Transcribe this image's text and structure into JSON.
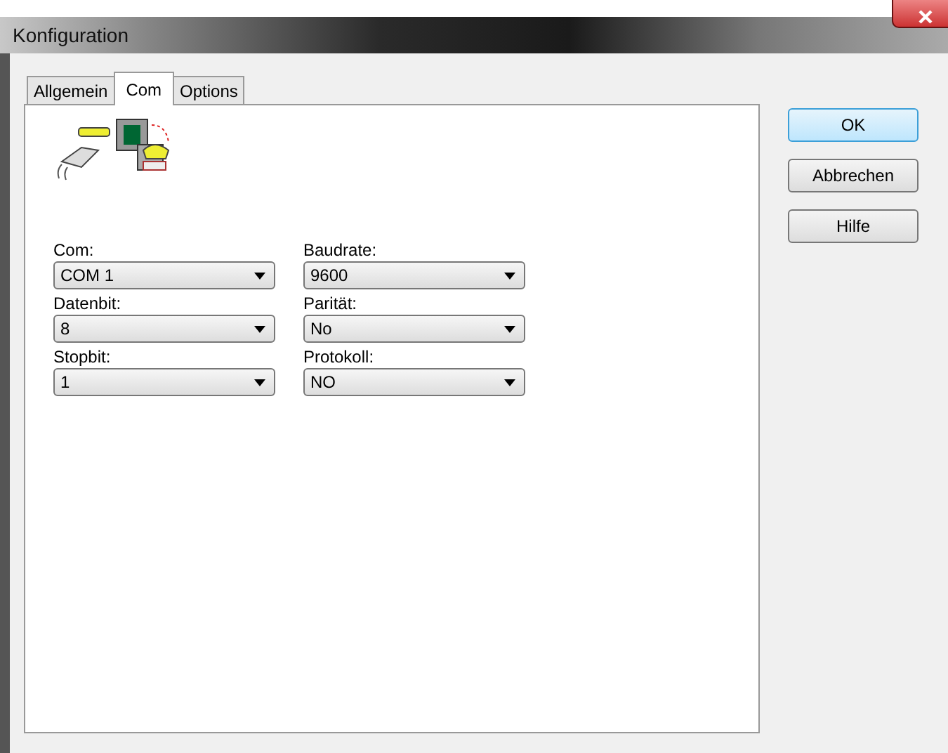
{
  "window": {
    "title": "Konfiguration"
  },
  "tabs": [
    {
      "label": "Allgemein",
      "selected": false
    },
    {
      "label": "Com",
      "selected": true
    },
    {
      "label": "Options",
      "selected": false
    }
  ],
  "fields": [
    {
      "label": "Com:",
      "value": "COM 1"
    },
    {
      "label": "Baudrate:",
      "value": "9600"
    },
    {
      "label": "Datenbit:",
      "value": "8"
    },
    {
      "label": "Parität:",
      "value": "No"
    },
    {
      "label": "Stopbit:",
      "value": "1"
    },
    {
      "label": "Protokoll:",
      "value": "NO"
    }
  ],
  "buttons": [
    {
      "label": "OK",
      "default": true
    },
    {
      "label": "Abbrechen",
      "default": false
    },
    {
      "label": "Hilfe",
      "default": false
    }
  ]
}
